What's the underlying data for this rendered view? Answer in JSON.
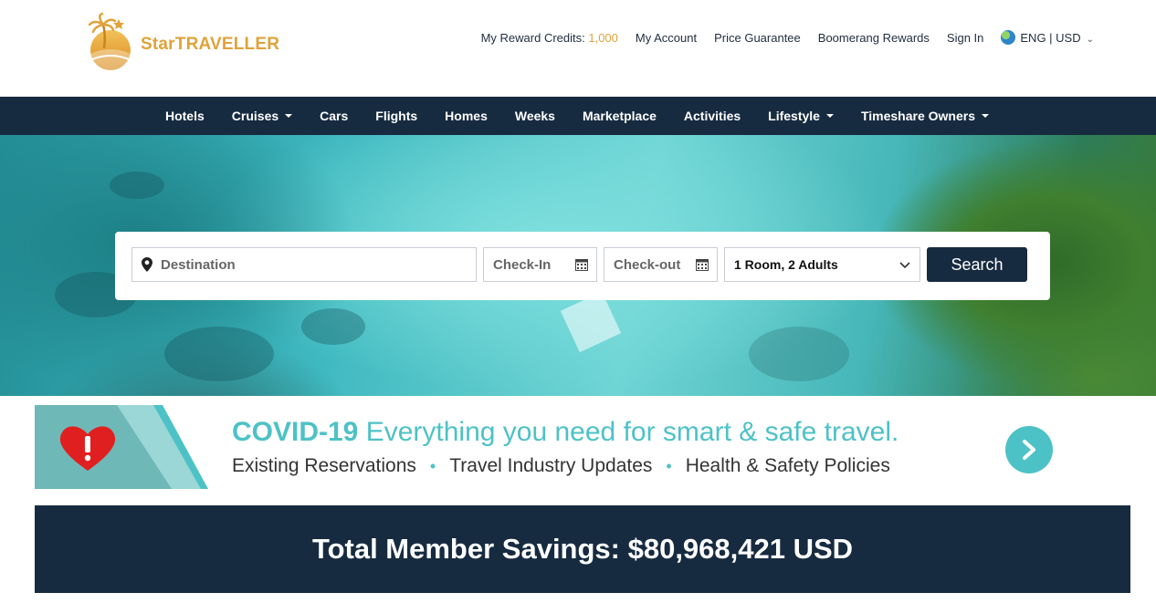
{
  "brand": {
    "name": "StarTRAVELLER",
    "accent": "#e0a23a"
  },
  "header": {
    "reward_label": "My Reward Credits:",
    "reward_value": "1,000",
    "my_account": "My Account",
    "price_guarantee": "Price Guarantee",
    "boomerang": "Boomerang Rewards",
    "sign_in": "Sign In",
    "locale": "ENG | USD"
  },
  "nav": {
    "items": [
      {
        "label": "Hotels"
      },
      {
        "label": "Cruises"
      },
      {
        "label": "Cars"
      },
      {
        "label": "Flights"
      },
      {
        "label": "Homes"
      },
      {
        "label": "Weeks"
      },
      {
        "label": "Marketplace"
      },
      {
        "label": "Activities"
      },
      {
        "label": "Lifestyle"
      },
      {
        "label": "Timeshare Owners"
      }
    ]
  },
  "search": {
    "destination_placeholder": "Destination",
    "checkin_placeholder": "Check-In",
    "checkout_placeholder": "Check-out",
    "rooms_value": "1 Room, 2 Adults",
    "button_label": "Search"
  },
  "covid": {
    "title_bold": "COVID-19",
    "title_rest": "Everything you need for smart & safe travel.",
    "link1": "Existing Reservations",
    "link2": "Travel Industry Updates",
    "link3": "Health & Safety Policies",
    "accent": "#4dc2c6"
  },
  "savings": {
    "text": "Total Member Savings: $80,968,421 USD"
  },
  "colors": {
    "navy": "#172b40",
    "teal": "#4dc2c6",
    "gold": "#e0a23a"
  }
}
